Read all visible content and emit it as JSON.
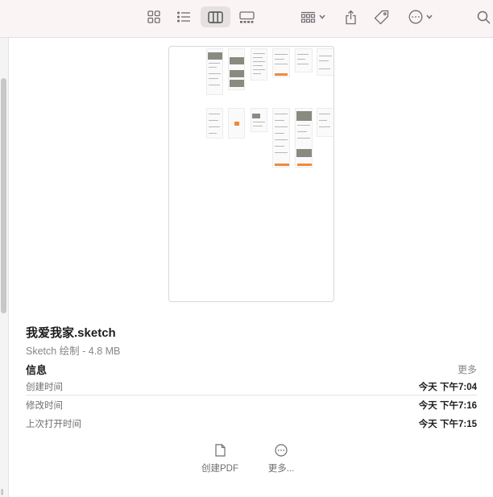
{
  "toolbar": {
    "icons": [
      "icon-view-grid",
      "icon-view-list",
      "icon-view-columns",
      "icon-view-gallery",
      "icon-group-by",
      "icon-share",
      "icon-tag",
      "icon-more-actions",
      "icon-search"
    ],
    "selected_view": "columns"
  },
  "file": {
    "name": "我爱我家.sketch",
    "kind": "Sketch 绘制 - 4.8 MB"
  },
  "info": {
    "title": "信息",
    "more_label": "更多",
    "rows": [
      {
        "label": "创建时间",
        "value": "今天 下午7:04"
      },
      {
        "label": "修改时间",
        "value": "今天 下午7:16"
      },
      {
        "label": "上次打开时间",
        "value": "今天 下午7:15"
      }
    ]
  },
  "actions": {
    "create_pdf": "创建PDF",
    "more": "更多..."
  },
  "colors": {
    "toolbar_bg": "#fbf4f4",
    "accent_orange": "#f08a3a"
  }
}
